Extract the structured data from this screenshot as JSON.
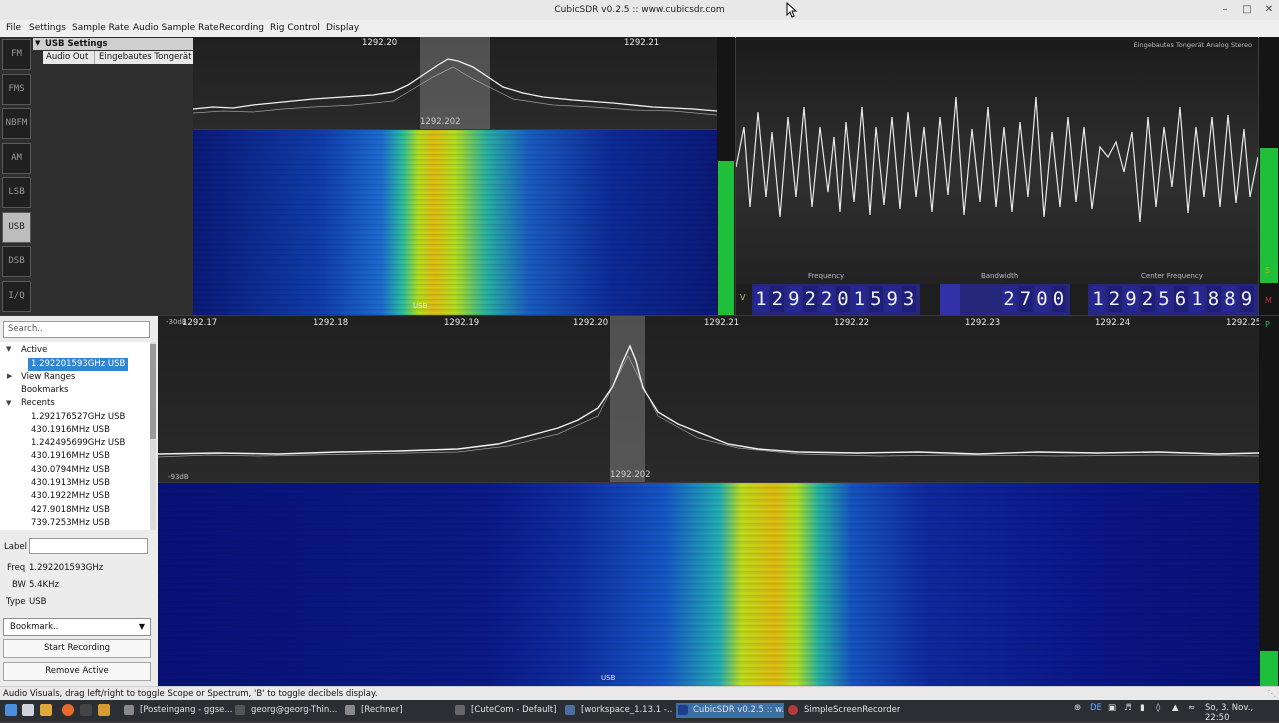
{
  "window": {
    "title": "CubicSDR v0.2.5 :: www.cubicsdr.com"
  },
  "menu": [
    "File",
    "Settings",
    "Sample Rate",
    "Audio Sample Rate",
    "Recording",
    "Rig Control",
    "Display"
  ],
  "modes": [
    {
      "label": "FM",
      "active": false
    },
    {
      "label": "FMS",
      "active": false
    },
    {
      "label": "NBFM",
      "active": false
    },
    {
      "label": "AM",
      "active": false
    },
    {
      "label": "LSB",
      "active": false
    },
    {
      "label": "USB",
      "active": true
    },
    {
      "label": "DSB",
      "active": false
    },
    {
      "label": "I/Q",
      "active": false
    }
  ],
  "settings_panel": {
    "title": "USB Settings",
    "key": "Audio Out",
    "value": "Eingebautes Tongerät Analog Stereo"
  },
  "top_spectrum": {
    "ticks": [
      "1292.20",
      "1292.21"
    ],
    "marker": "1292.202",
    "waterfall_marker": "USB"
  },
  "scope": {
    "audio_device": "Eingebautes Tongerät Analog Stereo",
    "labels": {
      "frequency": "Frequency",
      "bandwidth": "Bandwidth",
      "center": "Center Frequency"
    },
    "side_left": "V",
    "side_right_top": "S",
    "side_right_bottom": "M",
    "frequency_digits": "1292201593",
    "bandwidth_digits": "2700",
    "center_digits": "1292561889"
  },
  "main_spectrum": {
    "db_top": "-30dB",
    "db_bottom": "-93dB",
    "ticks": [
      "1292.17",
      "1292.18",
      "1292.19",
      "1292.20",
      "1292.21",
      "1292.22",
      "1292.23",
      "1292.24",
      "1292.25"
    ],
    "marker": "1292.202",
    "waterfall_marker": "USB",
    "peak_button": "P"
  },
  "bookmarks": {
    "search_placeholder": "Search..",
    "tree": {
      "active_group": "Active",
      "active_item": "1.292201593GHz USB",
      "view_ranges": "View Ranges",
      "bookmarks": "Bookmarks",
      "recents": "Recents",
      "recent_items": [
        "1.292176527GHz USB",
        "430.1916MHz USB",
        "1.242495699GHz USB",
        "430.1916MHz USB",
        "430.0794MHz USB",
        "430.1913MHz USB",
        "430.1922MHz USB",
        "427.9018MHz USB",
        "739.7253MHz USB"
      ]
    },
    "label_caption": "Label",
    "freq_key": "Freq",
    "freq_value": "1.292201593GHz",
    "bw_key": "BW",
    "bw_value": "5.4KHz",
    "type_key": "Type",
    "type_value": "USB",
    "bookmark_select": "Bookmark..",
    "start_recording": "Start Recording",
    "remove_active": "Remove Active"
  },
  "status": "Audio Visuals, drag left/right to toggle Scope or Spectrum, 'B' to toggle decibels display.",
  "taskbar": {
    "tasks": [
      {
        "label": "[Posteingang - ggse...",
        "active": false
      },
      {
        "label": "georg@georg-Thin...",
        "active": false
      },
      {
        "label": "[Rechner]",
        "active": false
      },
      {
        "label": "[CuteCom - Default]",
        "active": false
      },
      {
        "label": "[workspace_1.13.1 -...",
        "active": false
      },
      {
        "label": "CubicSDR v0.2.5 :: w...",
        "active": true
      },
      {
        "label": "SimpleScreenRecorder",
        "active": false
      }
    ],
    "keyboard": "DE",
    "clock": "So, 3. Nov., 22:50"
  }
}
